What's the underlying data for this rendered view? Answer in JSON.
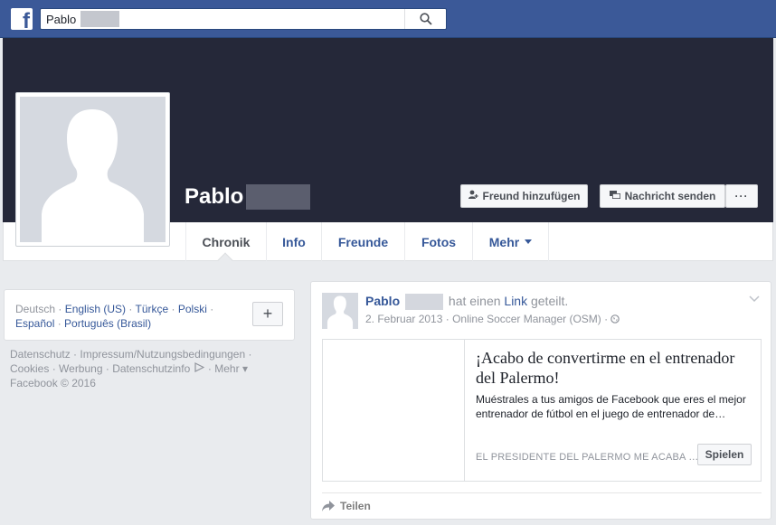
{
  "search": {
    "value": "Pablo"
  },
  "profile": {
    "name": "Pablo"
  },
  "cover_buttons": {
    "add_friend": "Freund hinzufügen",
    "send_message": "Nachricht senden",
    "more": "···"
  },
  "tabs": [
    {
      "label": "Chronik"
    },
    {
      "label": "Info"
    },
    {
      "label": "Freunde"
    },
    {
      "label": "Fotos"
    },
    {
      "label": "Mehr"
    }
  ],
  "languages": {
    "current": "Deutsch",
    "items": [
      "English (US)",
      "Türkçe",
      "Polski",
      "Español",
      "Português (Brasil)"
    ],
    "add_label": "+"
  },
  "footer": {
    "links": [
      "Datenschutz",
      "Impressum/Nutzungsbedingungen",
      "Cookies",
      "Werbung",
      "Datenschutzinfo",
      "Mehr"
    ],
    "copyright": "Facebook © 2016"
  },
  "post": {
    "author": "Pablo",
    "action_text": "hat einen",
    "link_word": "Link",
    "action_suffix": "geteilt.",
    "date": "2. Februar 2013",
    "app": "Online Soccer Manager (OSM)",
    "attachment": {
      "title": "¡Acabo de convertirme en el entrenador del Palermo!",
      "description": "Muéstrales a tus amigos de Facebook que eres el mejor entrenador de fútbol en el juego de entrenador de…",
      "caption": "EL PRESIDENTE DEL PALERMO ME ACABA …",
      "button": "Spielen"
    },
    "share_label": "Teilen"
  },
  "colors": {
    "brand": "#3b5998",
    "cover": "#252839",
    "link": "#365899"
  }
}
